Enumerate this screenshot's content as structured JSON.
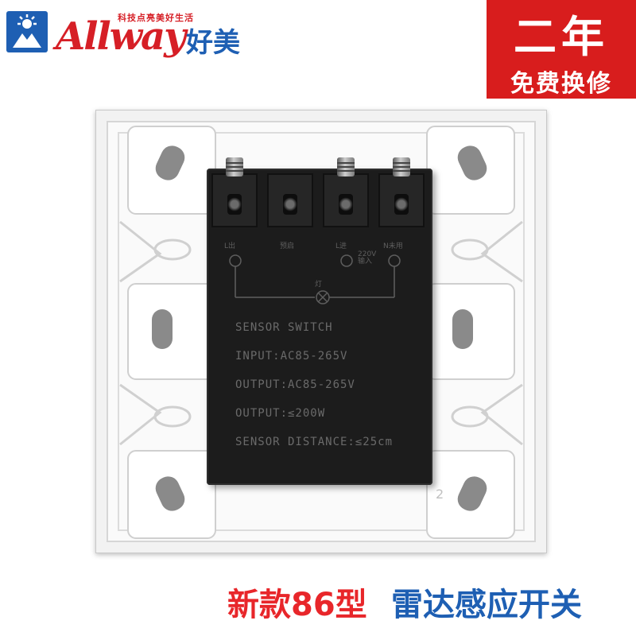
{
  "brand": {
    "name": "Allway",
    "tagline": "科技点亮美好生活",
    "chinese_name": "好美",
    "logo_icon": "person-sun-logo-icon",
    "colors": {
      "red": "#d61f26",
      "blue": "#1e5fb3"
    }
  },
  "promo": {
    "line1": "二年",
    "line2": "免费换修",
    "color": "#d81d1d"
  },
  "product": {
    "terminals": [
      "L出",
      "预启",
      "L进",
      "N未用"
    ],
    "input_note": "220V\n输入",
    "lamp_label": "灯",
    "lines": [
      "SENSOR SWITCH",
      "INPUT:AC85-265V",
      "OUTPUT:AC85-265V",
      "OUTPUT:≤200W",
      "SENSOR DISTANCE:≤25cm"
    ],
    "plate_mark": "2"
  },
  "caption": {
    "left": "新款86型",
    "right": "雷达感应开关",
    "colors": {
      "left": "#e8262a",
      "right": "#1e5fb3"
    }
  }
}
